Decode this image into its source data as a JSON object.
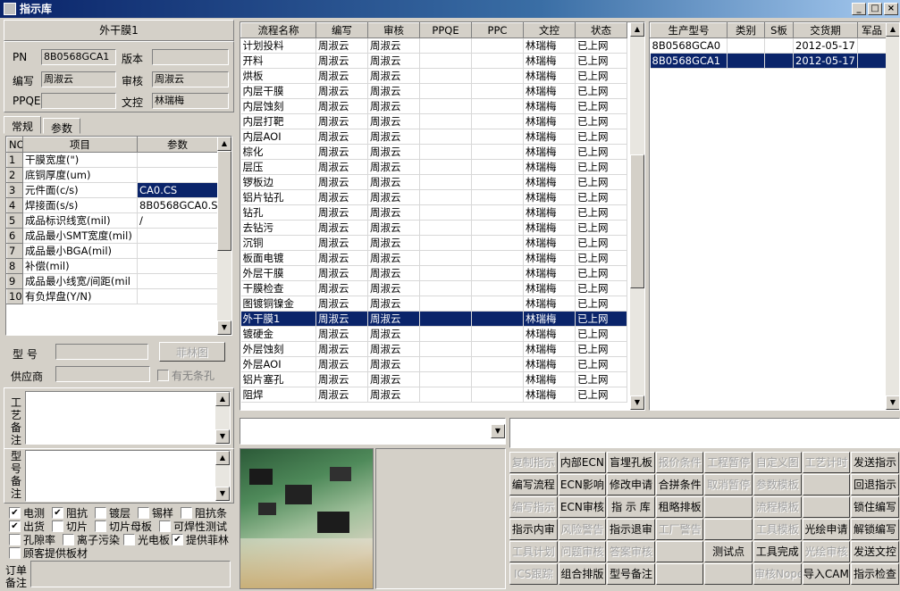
{
  "window": {
    "title": "指示库",
    "min": "_",
    "max": "□",
    "close": "×"
  },
  "left": {
    "header": "外干膜1",
    "fields": {
      "pn_label": "PN",
      "pn_value": "8B0568GCA1",
      "version_label": "版本",
      "version_value": "",
      "writer_label": "编写",
      "writer_value": "周淑云",
      "review_label": "审核",
      "review_value": "周淑云",
      "ppqe_label": "PPQE",
      "ppqe_value": "",
      "dc_label": "文控",
      "dc_value": "林瑞梅"
    },
    "tabs": [
      "常规",
      "参数"
    ],
    "param_headers": [
      "NO",
      "项目",
      "参数"
    ],
    "params": [
      {
        "no": "1",
        "item": "干膜宽度(\")",
        "value": ""
      },
      {
        "no": "2",
        "item": "底铜厚度(um)",
        "value": ""
      },
      {
        "no": "3",
        "item": "元件面(c/s)",
        "value": "CA0.CS"
      },
      {
        "no": "4",
        "item": "焊接面(s/s)",
        "value": "8B0568GCA0.SS"
      },
      {
        "no": "5",
        "item": "成品标识线宽(mil)",
        "value": "/"
      },
      {
        "no": "6",
        "item": "成品最小SMT宽度(mil)",
        "value": ""
      },
      {
        "no": "7",
        "item": "成品最小BGA(mil)",
        "value": ""
      },
      {
        "no": "8",
        "item": "补偿(mil)",
        "value": ""
      },
      {
        "no": "9",
        "item": "成品最小线宽/间距(mil",
        "value": ""
      },
      {
        "no": "10",
        "item": "有负焊盘(Y/N)",
        "value": ""
      }
    ],
    "model_label": "型 号",
    "model_value": "",
    "film_button": "菲林图",
    "supplier_label": "供应商",
    "supplier_value": "",
    "no_strip_label": "有无条孔",
    "process_note_label": "工艺备注",
    "model_note_label": "型号备注",
    "checkboxes": [
      {
        "label": "电测",
        "checked": true
      },
      {
        "label": "阻抗",
        "checked": true
      },
      {
        "label": "镀层",
        "checked": false
      },
      {
        "label": "锡样",
        "checked": false
      },
      {
        "label": "阻抗条",
        "checked": false
      },
      {
        "label": "出货",
        "checked": true
      },
      {
        "label": "切片",
        "checked": false
      },
      {
        "label": "切片母板",
        "checked": false
      },
      {
        "label": "可焊性测试",
        "checked": false
      },
      {
        "label": "孔隙率",
        "checked": false
      },
      {
        "label": "离子污染",
        "checked": false
      },
      {
        "label": "光电板",
        "checked": false
      },
      {
        "label": "提供菲林",
        "checked": true
      },
      {
        "label": "顾客提供板材",
        "checked": false
      }
    ],
    "order_note_label": "订单备注"
  },
  "flow": {
    "headers": [
      "流程名称",
      "编写",
      "审核",
      "PPQE",
      "PPC",
      "文控",
      "状态"
    ],
    "rows": [
      [
        "计划投料",
        "周淑云",
        "周淑云",
        "",
        "",
        "林瑞梅",
        "已上网"
      ],
      [
        "开料",
        "周淑云",
        "周淑云",
        "",
        "",
        "林瑞梅",
        "已上网"
      ],
      [
        "烘板",
        "周淑云",
        "周淑云",
        "",
        "",
        "林瑞梅",
        "已上网"
      ],
      [
        "内层干膜",
        "周淑云",
        "周淑云",
        "",
        "",
        "林瑞梅",
        "已上网"
      ],
      [
        "内层蚀刻",
        "周淑云",
        "周淑云",
        "",
        "",
        "林瑞梅",
        "已上网"
      ],
      [
        "内层打靶",
        "周淑云",
        "周淑云",
        "",
        "",
        "林瑞梅",
        "已上网"
      ],
      [
        "内层AOI",
        "周淑云",
        "周淑云",
        "",
        "",
        "林瑞梅",
        "已上网"
      ],
      [
        "棕化",
        "周淑云",
        "周淑云",
        "",
        "",
        "林瑞梅",
        "已上网"
      ],
      [
        "层压",
        "周淑云",
        "周淑云",
        "",
        "",
        "林瑞梅",
        "已上网"
      ],
      [
        "锣板边",
        "周淑云",
        "周淑云",
        "",
        "",
        "林瑞梅",
        "已上网"
      ],
      [
        "铝片钻孔",
        "周淑云",
        "周淑云",
        "",
        "",
        "林瑞梅",
        "已上网"
      ],
      [
        "钻孔",
        "周淑云",
        "周淑云",
        "",
        "",
        "林瑞梅",
        "已上网"
      ],
      [
        "去钻污",
        "周淑云",
        "周淑云",
        "",
        "",
        "林瑞梅",
        "已上网"
      ],
      [
        "沉铜",
        "周淑云",
        "周淑云",
        "",
        "",
        "林瑞梅",
        "已上网"
      ],
      [
        "板面电镀",
        "周淑云",
        "周淑云",
        "",
        "",
        "林瑞梅",
        "已上网"
      ],
      [
        "外层干膜",
        "周淑云",
        "周淑云",
        "",
        "",
        "林瑞梅",
        "已上网"
      ],
      [
        "干膜检查",
        "周淑云",
        "周淑云",
        "",
        "",
        "林瑞梅",
        "已上网"
      ],
      [
        "图镀铜镍金",
        "周淑云",
        "周淑云",
        "",
        "",
        "林瑞梅",
        "已上网"
      ],
      [
        "外干膜1",
        "周淑云",
        "周淑云",
        "",
        "",
        "林瑞梅",
        "已上网"
      ],
      [
        "镀硬金",
        "周淑云",
        "周淑云",
        "",
        "",
        "林瑞梅",
        "已上网"
      ],
      [
        "外层蚀刻",
        "周淑云",
        "周淑云",
        "",
        "",
        "林瑞梅",
        "已上网"
      ],
      [
        "外层AOI",
        "周淑云",
        "周淑云",
        "",
        "",
        "林瑞梅",
        "已上网"
      ],
      [
        "铝片塞孔",
        "周淑云",
        "周淑云",
        "",
        "",
        "林瑞梅",
        "已上网"
      ],
      [
        "阻焊",
        "周淑云",
        "周淑云",
        "",
        "",
        "林瑞梅",
        "已上网"
      ]
    ],
    "selected_index": 18
  },
  "orders": {
    "headers": [
      "生产型号",
      "类别",
      "S板",
      "交货期",
      "军品"
    ],
    "rows": [
      [
        "8B0568GCA0",
        "",
        "",
        "2012-05-17",
        ""
      ],
      [
        "8B0568GCA1",
        "",
        "",
        "2012-05-17",
        ""
      ]
    ],
    "selected_index": 1
  },
  "buttons": [
    [
      {
        "t": "复制指示",
        "d": true
      },
      {
        "t": "内部ECN",
        "d": false
      },
      {
        "t": "盲埋孔板",
        "d": false
      },
      {
        "t": "报价条件",
        "d": true
      },
      {
        "t": "工程暂停",
        "d": true
      },
      {
        "t": "自定义图",
        "d": true
      },
      {
        "t": "工艺计时",
        "d": true
      },
      {
        "t": "发送指示",
        "d": false
      }
    ],
    [
      {
        "t": "编写流程",
        "d": false
      },
      {
        "t": "ECN影响",
        "d": false
      },
      {
        "t": "修改申请",
        "d": false
      },
      {
        "t": "合拼条件",
        "d": false
      },
      {
        "t": "取消暂停",
        "d": true
      },
      {
        "t": "参数模板",
        "d": true
      },
      {
        "t": "",
        "d": false
      },
      {
        "t": "回退指示",
        "d": false
      }
    ],
    [
      {
        "t": "编写指示",
        "d": true
      },
      {
        "t": "ECN审核",
        "d": false
      },
      {
        "t": "指 示 库",
        "d": false
      },
      {
        "t": "租略排板",
        "d": false
      },
      {
        "t": "",
        "d": false
      },
      {
        "t": "流程模板",
        "d": true
      },
      {
        "t": "",
        "d": false
      },
      {
        "t": "锁住编写",
        "d": false
      }
    ],
    [
      {
        "t": "指示内审",
        "d": false
      },
      {
        "t": "风险警告",
        "d": true
      },
      {
        "t": "指示退审",
        "d": false
      },
      {
        "t": "工厂警告",
        "d": true
      },
      {
        "t": "",
        "d": false
      },
      {
        "t": "工具模板",
        "d": true
      },
      {
        "t": "光绘申请",
        "d": false
      },
      {
        "t": "解锁编写",
        "d": false
      }
    ],
    [
      {
        "t": "工具计划",
        "d": true
      },
      {
        "t": "问题审核",
        "d": true
      },
      {
        "t": "答案审核",
        "d": true
      },
      {
        "t": "",
        "d": false
      },
      {
        "t": "测试点",
        "d": false
      },
      {
        "t": "工具完成",
        "d": false
      },
      {
        "t": "光绘审核",
        "d": true
      },
      {
        "t": "发送文控",
        "d": false
      }
    ],
    [
      {
        "t": "ICS跟踪",
        "d": true
      },
      {
        "t": "组合排版",
        "d": false
      },
      {
        "t": "型号备注",
        "d": false
      },
      {
        "t": "",
        "d": false
      },
      {
        "t": "",
        "d": false
      },
      {
        "t": "审核Nope",
        "d": true
      },
      {
        "t": "导入CAM",
        "d": false
      },
      {
        "t": "指示检查",
        "d": false
      }
    ]
  ]
}
